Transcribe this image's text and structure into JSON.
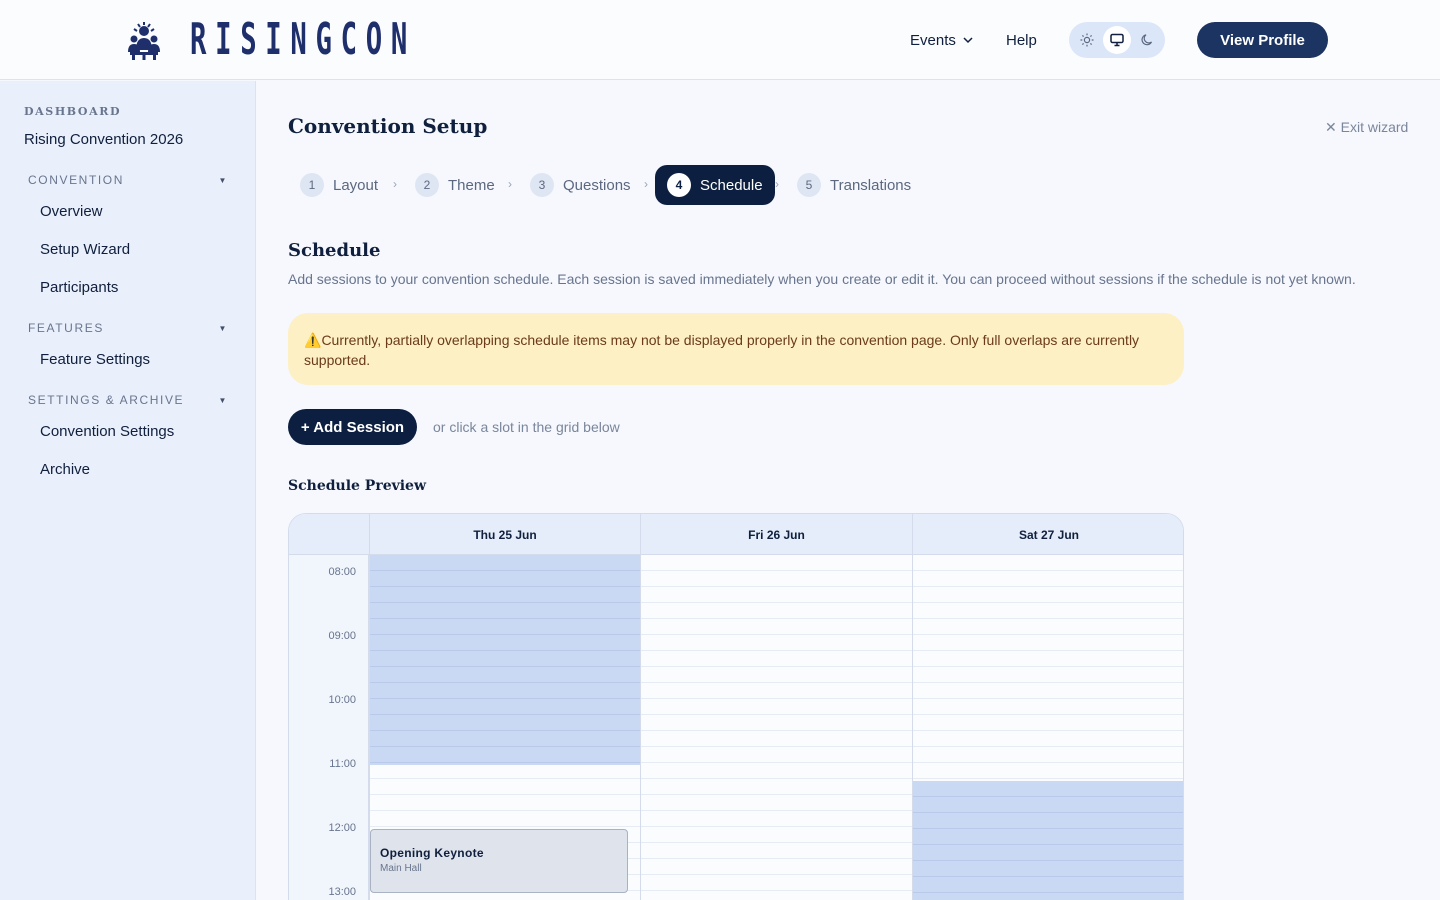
{
  "header": {
    "brand": "RISINGCON",
    "nav_events": "Events",
    "nav_help": "Help",
    "theme_options": [
      "sun-icon",
      "monitor-icon",
      "moon-icon"
    ],
    "theme_selected": "monitor-icon",
    "profile_button": "View Profile"
  },
  "sidebar": {
    "dashboard_label": "DASHBOARD",
    "convention_name": "Rising Convention 2026",
    "sections": [
      {
        "label": "CONVENTION",
        "items": [
          "Overview",
          "Setup Wizard",
          "Participants"
        ]
      },
      {
        "label": "FEATURES",
        "items": [
          "Feature Settings"
        ]
      },
      {
        "label": "SETTINGS & ARCHIVE",
        "items": [
          "Convention Settings",
          "Archive"
        ]
      }
    ]
  },
  "main": {
    "title": "Convention Setup",
    "exit_wizard": "✕ Exit wizard",
    "steps": [
      {
        "num": "1",
        "label": "Layout"
      },
      {
        "num": "2",
        "label": "Theme"
      },
      {
        "num": "3",
        "label": "Questions"
      },
      {
        "num": "4",
        "label": "Schedule"
      },
      {
        "num": "5",
        "label": "Translations"
      }
    ],
    "active_step": 4,
    "section_title": "Schedule",
    "section_desc": "Add sessions to your convention schedule. Each session is saved immediately when you create or edit it. You can proceed without sessions if the schedule is not yet known.",
    "alert_icon": "⚠️",
    "alert_text": "Currently, partially overlapping schedule items may not be displayed properly in the convention page. Only full overlaps are currently supported.",
    "add_button": "+ Add Session",
    "add_hint": "or click a slot in the grid below",
    "preview_title": "Schedule Preview"
  },
  "schedule": {
    "days": [
      "Thu 25 Jun",
      "Fri 26 Jun",
      "Sat 27 Jun"
    ],
    "times": [
      "08:00",
      "09:00",
      "10:00",
      "11:00",
      "12:00",
      "13:00"
    ],
    "sessions": [
      {
        "name": "Opening Keynote",
        "room": "Main Hall",
        "day": "Thu 25 Jun",
        "start": "12:00"
      }
    ],
    "colors": {
      "highlight": "#c9d8f3",
      "accent": "#0d1f40",
      "alert_bg": "#fdf0c4"
    }
  }
}
